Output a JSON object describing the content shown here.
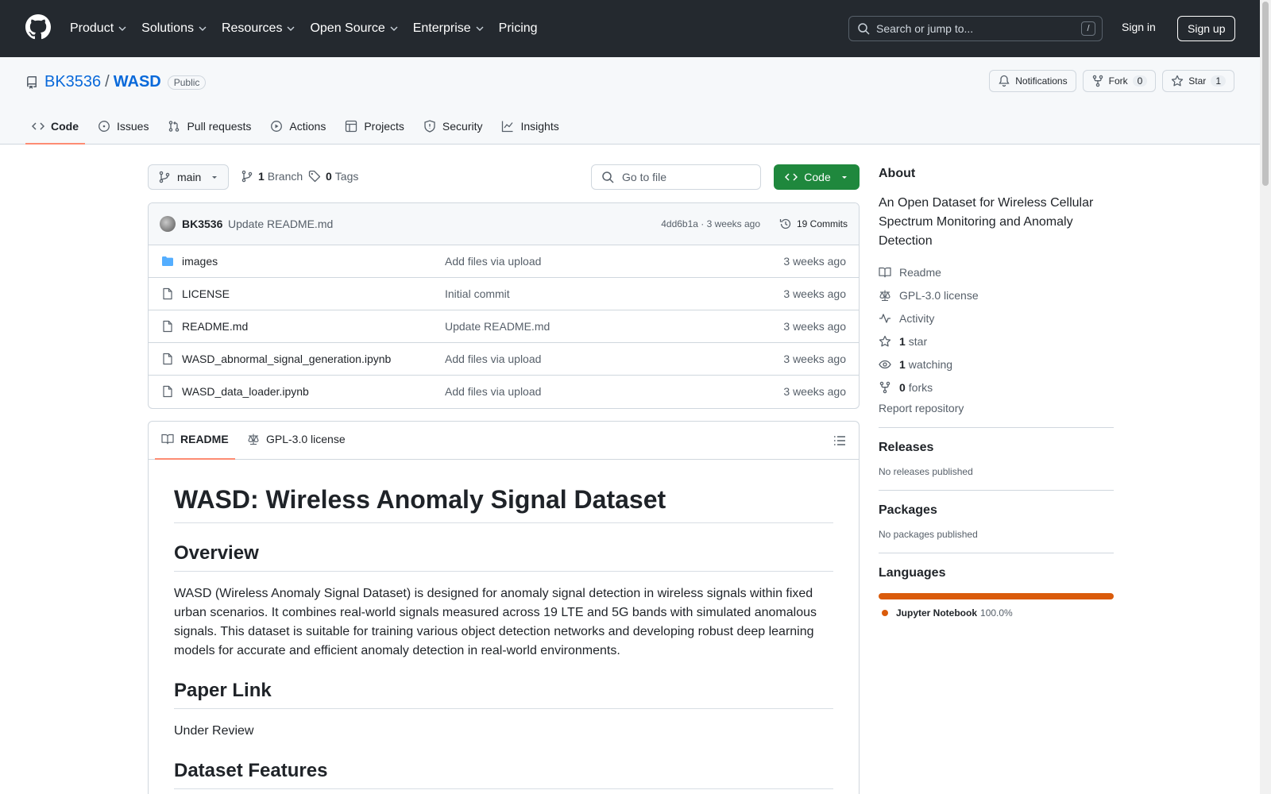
{
  "topnav": {
    "items": [
      {
        "label": "Product",
        "has_menu": true
      },
      {
        "label": "Solutions",
        "has_menu": true
      },
      {
        "label": "Resources",
        "has_menu": true
      },
      {
        "label": "Open Source",
        "has_menu": true
      },
      {
        "label": "Enterprise",
        "has_menu": true
      },
      {
        "label": "Pricing",
        "has_menu": false
      }
    ],
    "search_placeholder": "Search or jump to...",
    "search_shortcut": "/",
    "sign_in": "Sign in",
    "sign_up": "Sign up"
  },
  "repo": {
    "owner": "BK3536",
    "separator": "/",
    "name": "WASD",
    "visibility": "Public",
    "notifications_label": "Notifications",
    "fork_label": "Fork",
    "fork_count": "0",
    "star_label": "Star",
    "star_count": "1"
  },
  "tabs": [
    {
      "label": "Code",
      "icon": "code-icon",
      "active": true
    },
    {
      "label": "Issues",
      "icon": "issue-icon"
    },
    {
      "label": "Pull requests",
      "icon": "pull-request-icon"
    },
    {
      "label": "Actions",
      "icon": "play-icon"
    },
    {
      "label": "Projects",
      "icon": "table-icon"
    },
    {
      "label": "Security",
      "icon": "shield-icon"
    },
    {
      "label": "Insights",
      "icon": "graph-icon"
    }
  ],
  "toolbar": {
    "branch": "main",
    "branch_count": "1",
    "branch_label": "Branch",
    "tag_count": "0",
    "tag_label": "Tags",
    "go_to_file_placeholder": "Go to file",
    "code_button": "Code"
  },
  "commit": {
    "author": "BK3536",
    "message": "Update README.md",
    "sha_time": "4dd6b1a · 3 weeks ago",
    "commits_label": "19 Commits"
  },
  "files": [
    {
      "name": "images",
      "type": "folder",
      "message": "Add files via upload",
      "date": "3 weeks ago"
    },
    {
      "name": "LICENSE",
      "type": "file",
      "message": "Initial commit",
      "date": "3 weeks ago"
    },
    {
      "name": "README.md",
      "type": "file",
      "message": "Update README.md",
      "date": "3 weeks ago"
    },
    {
      "name": "WASD_abnormal_signal_generation.ipynb",
      "type": "file",
      "message": "Add files via upload",
      "date": "3 weeks ago"
    },
    {
      "name": "WASD_data_loader.ipynb",
      "type": "file",
      "message": "Add files via upload",
      "date": "3 weeks ago"
    }
  ],
  "readme": {
    "tab_readme": "README",
    "tab_license": "GPL-3.0 license",
    "h1": "WASD: Wireless Anomaly Signal Dataset",
    "overview_heading": "Overview",
    "overview_text": "WASD (Wireless Anomaly Signal Dataset) is designed for anomaly signal detection in wireless signals within fixed urban scenarios. It combines real-world signals measured across 19 LTE and 5G bands with simulated anomalous signals. This dataset is suitable for training various object detection networks and developing robust deep learning models for accurate and efficient anomaly detection in real-world environments.",
    "paper_heading": "Paper Link",
    "paper_text": "Under Review",
    "features_heading": "Dataset Features"
  },
  "about": {
    "heading": "About",
    "description": "An Open Dataset for Wireless Cellular Spectrum Monitoring and Anomaly Detection",
    "links": [
      {
        "icon": "book-icon",
        "strong": "",
        "label": "Readme"
      },
      {
        "icon": "law-icon",
        "strong": "",
        "label": "GPL-3.0 license"
      },
      {
        "icon": "pulse-icon",
        "strong": "",
        "label": "Activity"
      },
      {
        "icon": "star-icon",
        "strong": "1",
        "label": "star"
      },
      {
        "icon": "eye-icon",
        "strong": "1",
        "label": "watching"
      },
      {
        "icon": "fork-icon",
        "strong": "0",
        "label": "forks"
      }
    ],
    "report": "Report repository"
  },
  "releases": {
    "heading": "Releases",
    "text": "No releases published"
  },
  "packages": {
    "heading": "Packages",
    "text": "No packages published"
  },
  "languages": {
    "heading": "Languages",
    "items": [
      {
        "name": "Jupyter Notebook",
        "percent": "100.0%",
        "color": "#DA5B0B"
      }
    ]
  }
}
